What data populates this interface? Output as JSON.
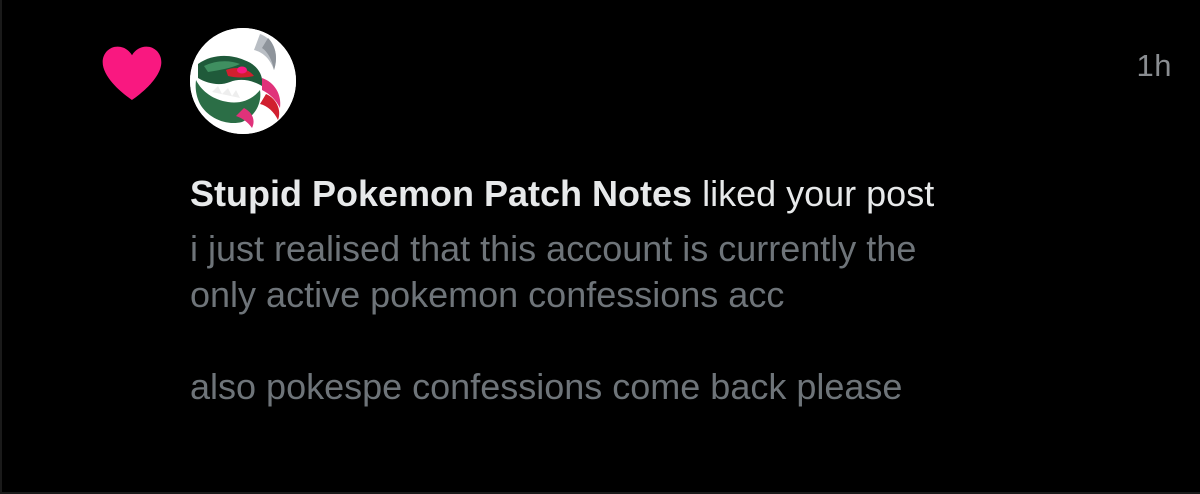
{
  "notification": {
    "type_icon": "heart-icon",
    "accent_color": "#f91880",
    "timestamp": "1h",
    "user_name": "Stupid Pokemon Patch Notes",
    "action_text": " liked your post",
    "avatar_icon": "pokemon-avatar",
    "post_text": "i just realised that this account is currently the\nonly active pokemon confessions acc\n\nalso pokespe confessions come back please"
  }
}
